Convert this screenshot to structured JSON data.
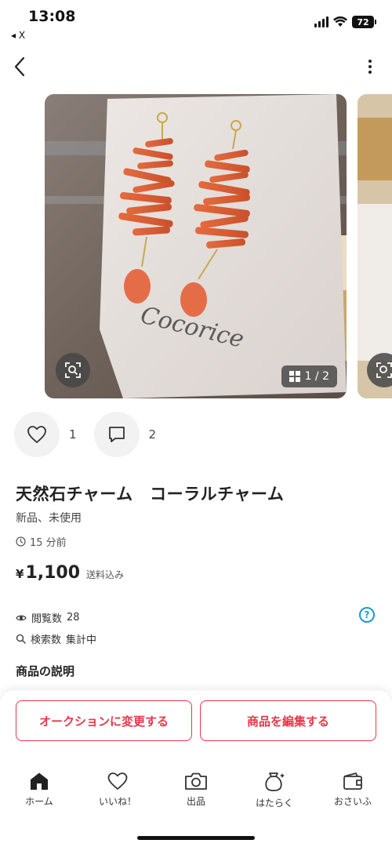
{
  "status": {
    "time": "13:08",
    "back_app": "◂ X",
    "battery": "72"
  },
  "gallery": {
    "counter": "1 / 2"
  },
  "engagement": {
    "likes": "1",
    "comments": "2"
  },
  "item": {
    "title": "天然石チャーム　コーラルチャーム",
    "condition": "新品、未使用",
    "posted": "15 分前",
    "price_symbol": "¥",
    "price": "1,100",
    "shipping_note": "送料込み"
  },
  "stats": {
    "views_label": "閲覧数",
    "views_value": "28",
    "search_label": "検索数",
    "search_value": "集計中",
    "help": "?"
  },
  "section": {
    "description_title": "商品の説明"
  },
  "buttons": {
    "auction": "オークションに変更する",
    "edit": "商品を編集する"
  },
  "tabs": [
    {
      "label": "ホーム",
      "icon": "home-icon"
    },
    {
      "label": "いいね！",
      "icon": "heart-icon"
    },
    {
      "label": "出品",
      "icon": "camera-icon"
    },
    {
      "label": "はたらく",
      "icon": "money-bag-icon"
    },
    {
      "label": "おさいふ",
      "icon": "wallet-icon"
    }
  ],
  "colors": {
    "accent": "#e8374a",
    "help": "#1a9bd1"
  }
}
